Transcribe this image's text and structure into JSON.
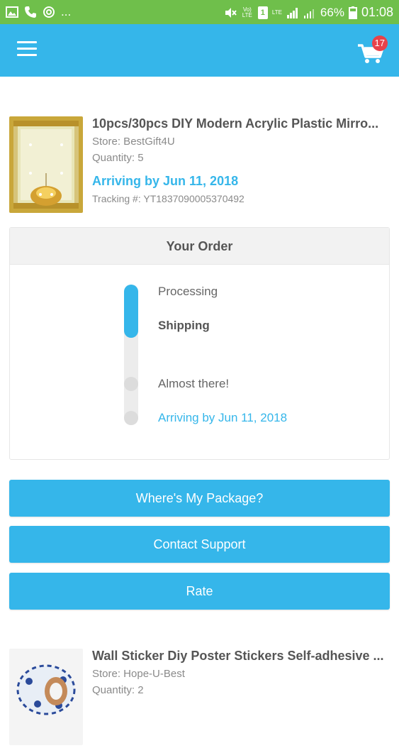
{
  "status_bar": {
    "battery": "66%",
    "time": "01:08",
    "dots": "...",
    "volte": "Vo) LTE",
    "sim": "1",
    "lte": "LTE"
  },
  "app_bar": {
    "cart_count": "17"
  },
  "products": [
    {
      "title": "10pcs/30pcs DIY Modern Acrylic Plastic Mirro...",
      "store": "Store: BestGift4U",
      "quantity": "Quantity: 5",
      "arriving": "Arriving by Jun 11, 2018",
      "tracking": "Tracking #: YT1837090005370492"
    },
    {
      "title": "Wall Sticker Diy Poster Stickers Self-adhesive ...",
      "store": "Store: Hope-U-Best",
      "quantity": "Quantity: 2"
    }
  ],
  "order": {
    "heading": "Your Order",
    "steps": [
      "Processing",
      "Shipping",
      "Almost there!",
      "Arriving by Jun 11, 2018"
    ],
    "progress_fraction": 0.38
  },
  "buttons": {
    "wheres_my_package": "Where's My Package?",
    "contact_support": "Contact Support",
    "rate": "Rate"
  },
  "colors": {
    "status_bar": "#6fbf4b",
    "app_bar": "#35b6ea",
    "accent": "#35b6ea",
    "badge": "#e8424a"
  }
}
